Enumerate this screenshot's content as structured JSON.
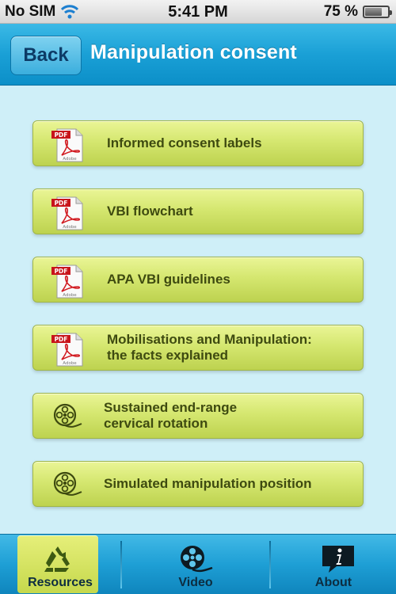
{
  "status": {
    "carrier": "No SIM",
    "time": "5:41 PM",
    "battery_text": "75 %",
    "battery_level": 0.75
  },
  "nav": {
    "back_label": "Back",
    "title": "Manipulation consent"
  },
  "items": [
    {
      "label_line1": "Informed consent labels",
      "label_line2": "",
      "icon": "pdf-icon"
    },
    {
      "label_line1": "VBI flowchart",
      "label_line2": "",
      "icon": "pdf-icon"
    },
    {
      "label_line1": "APA VBI guidelines",
      "label_line2": "",
      "icon": "pdf-icon"
    },
    {
      "label_line1": "Mobilisations and Manipulation:",
      "label_line2": "the facts explained",
      "icon": "pdf-icon"
    },
    {
      "label_line1": "Sustained end-range",
      "label_line2": "cervical rotation",
      "icon": "film-reel-icon"
    },
    {
      "label_line1": "Simulated manipulation position",
      "label_line2": "",
      "icon": "film-reel-icon"
    }
  ],
  "pdf_badge": "PDF",
  "pdf_brand": "Adobe",
  "tabs": [
    {
      "label": "Resources",
      "icon": "recycle-icon",
      "selected": true
    },
    {
      "label": "Video",
      "icon": "film-reel-icon",
      "selected": false
    },
    {
      "label": "About",
      "icon": "info-icon",
      "selected": false
    }
  ],
  "colors": {
    "accent_blue": "#1aa0d6",
    "content_bg": "#cfeff8",
    "button_green": "#d5e770",
    "label_text": "#3e4a10"
  }
}
